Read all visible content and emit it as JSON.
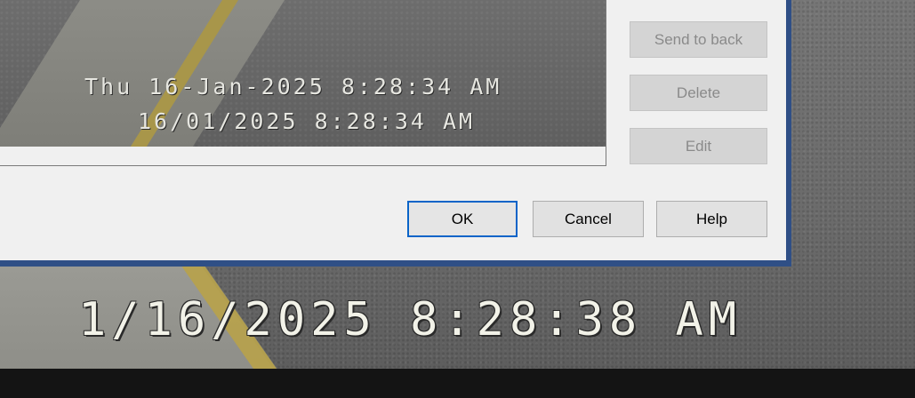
{
  "preview": {
    "timestamp_line1": "Thu 16-Jan-2025 8:28:34 AM",
    "timestamp_line2": "16/01/2025 8:28:34 AM"
  },
  "side_buttons": {
    "send_to_back": "Send to back",
    "delete": "Delete",
    "edit": "Edit"
  },
  "footer_buttons": {
    "ok": "OK",
    "cancel": "Cancel",
    "help": "Help"
  },
  "camera_overlay": {
    "timestamp": "1/16/2025 8:28:38 AM"
  },
  "colors": {
    "dialog_border": "#2f4f86",
    "dialog_bg": "#f0f0f0",
    "default_button_border": "#0a64c8"
  }
}
